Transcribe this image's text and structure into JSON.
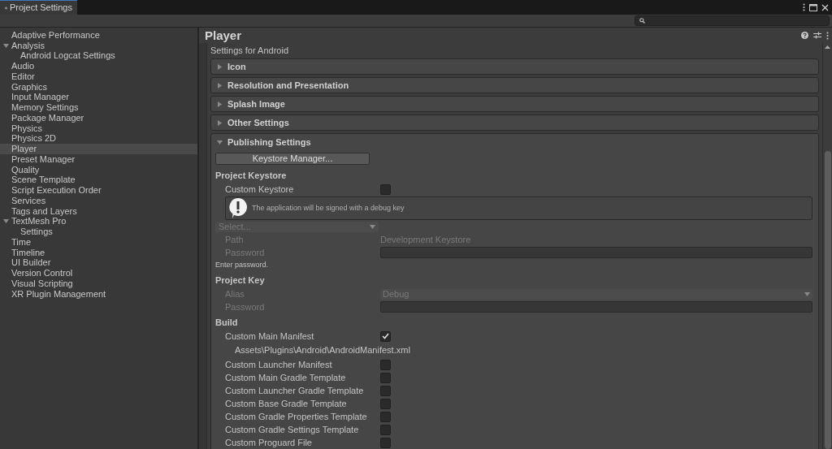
{
  "window": {
    "tab": "Project Settings"
  },
  "sidebar": {
    "items": [
      {
        "label": "Adaptive Performance",
        "selected": false
      },
      {
        "label": "Analysis",
        "selected": false,
        "expanded": true,
        "children": [
          {
            "label": "Android Logcat Settings",
            "selected": false
          }
        ]
      },
      {
        "label": "Audio",
        "selected": false
      },
      {
        "label": "Editor",
        "selected": false
      },
      {
        "label": "Graphics",
        "selected": false
      },
      {
        "label": "Input Manager",
        "selected": false
      },
      {
        "label": "Memory Settings",
        "selected": false
      },
      {
        "label": "Package Manager",
        "selected": false
      },
      {
        "label": "Physics",
        "selected": false
      },
      {
        "label": "Physics 2D",
        "selected": false
      },
      {
        "label": "Player",
        "selected": true
      },
      {
        "label": "Preset Manager",
        "selected": false
      },
      {
        "label": "Quality",
        "selected": false
      },
      {
        "label": "Scene Template",
        "selected": false
      },
      {
        "label": "Script Execution Order",
        "selected": false
      },
      {
        "label": "Services",
        "selected": false
      },
      {
        "label": "Tags and Layers",
        "selected": false
      },
      {
        "label": "TextMesh Pro",
        "selected": false,
        "expanded": true,
        "children": [
          {
            "label": "Settings",
            "selected": false
          }
        ]
      },
      {
        "label": "Time",
        "selected": false
      },
      {
        "label": "Timeline",
        "selected": false
      },
      {
        "label": "UI Builder",
        "selected": false
      },
      {
        "label": "Version Control",
        "selected": false
      },
      {
        "label": "Visual Scripting",
        "selected": false
      },
      {
        "label": "XR Plugin Management",
        "selected": false
      }
    ]
  },
  "inspector": {
    "title": "Player",
    "subtitle": "Settings for Android",
    "sections": [
      {
        "label": "Icon",
        "expanded": false
      },
      {
        "label": "Resolution and Presentation",
        "expanded": false
      },
      {
        "label": "Splash Image",
        "expanded": false
      },
      {
        "label": "Other Settings",
        "expanded": false
      },
      {
        "label": "Publishing Settings",
        "expanded": true
      }
    ],
    "rows": [
      {
        "kind": "button",
        "label": "Keystore Manager..."
      },
      {
        "kind": "heading",
        "label": "Project Keystore"
      },
      {
        "kind": "checkbox",
        "label": "Custom Keystore",
        "checked": false
      },
      {
        "kind": "help",
        "text": "The application will be signed with a debug key"
      },
      {
        "kind": "select",
        "value": "Select...",
        "disabled": true
      },
      {
        "kind": "value",
        "label": "Path",
        "value": "Development Keystore",
        "disabled": true
      },
      {
        "kind": "password",
        "label": "Password",
        "disabled": true
      },
      {
        "kind": "note",
        "text": "Enter password."
      },
      {
        "kind": "heading",
        "label": "Project Key"
      },
      {
        "kind": "popup",
        "label": "Alias",
        "value": "Debug",
        "disabled": true
      },
      {
        "kind": "password",
        "label": "Password",
        "disabled": true
      },
      {
        "kind": "heading",
        "label": "Build"
      },
      {
        "kind": "checkbox",
        "label": "Custom Main Manifest",
        "checked": true
      },
      {
        "kind": "path",
        "text": "Assets\\Plugins\\Android\\AndroidManifest.xml"
      },
      {
        "kind": "checkbox",
        "label": "Custom Launcher Manifest",
        "checked": false
      },
      {
        "kind": "checkbox",
        "label": "Custom Main Gradle Template",
        "checked": false
      },
      {
        "kind": "checkbox",
        "label": "Custom Launcher Gradle Template",
        "checked": false
      },
      {
        "kind": "checkbox",
        "label": "Custom Base Gradle Template",
        "checked": false
      },
      {
        "kind": "checkbox",
        "label": "Custom Gradle Properties Template",
        "checked": false
      },
      {
        "kind": "checkbox",
        "label": "Custom Gradle Settings Template",
        "checked": false
      },
      {
        "kind": "checkbox",
        "label": "Custom Proguard File",
        "checked": false
      }
    ]
  }
}
